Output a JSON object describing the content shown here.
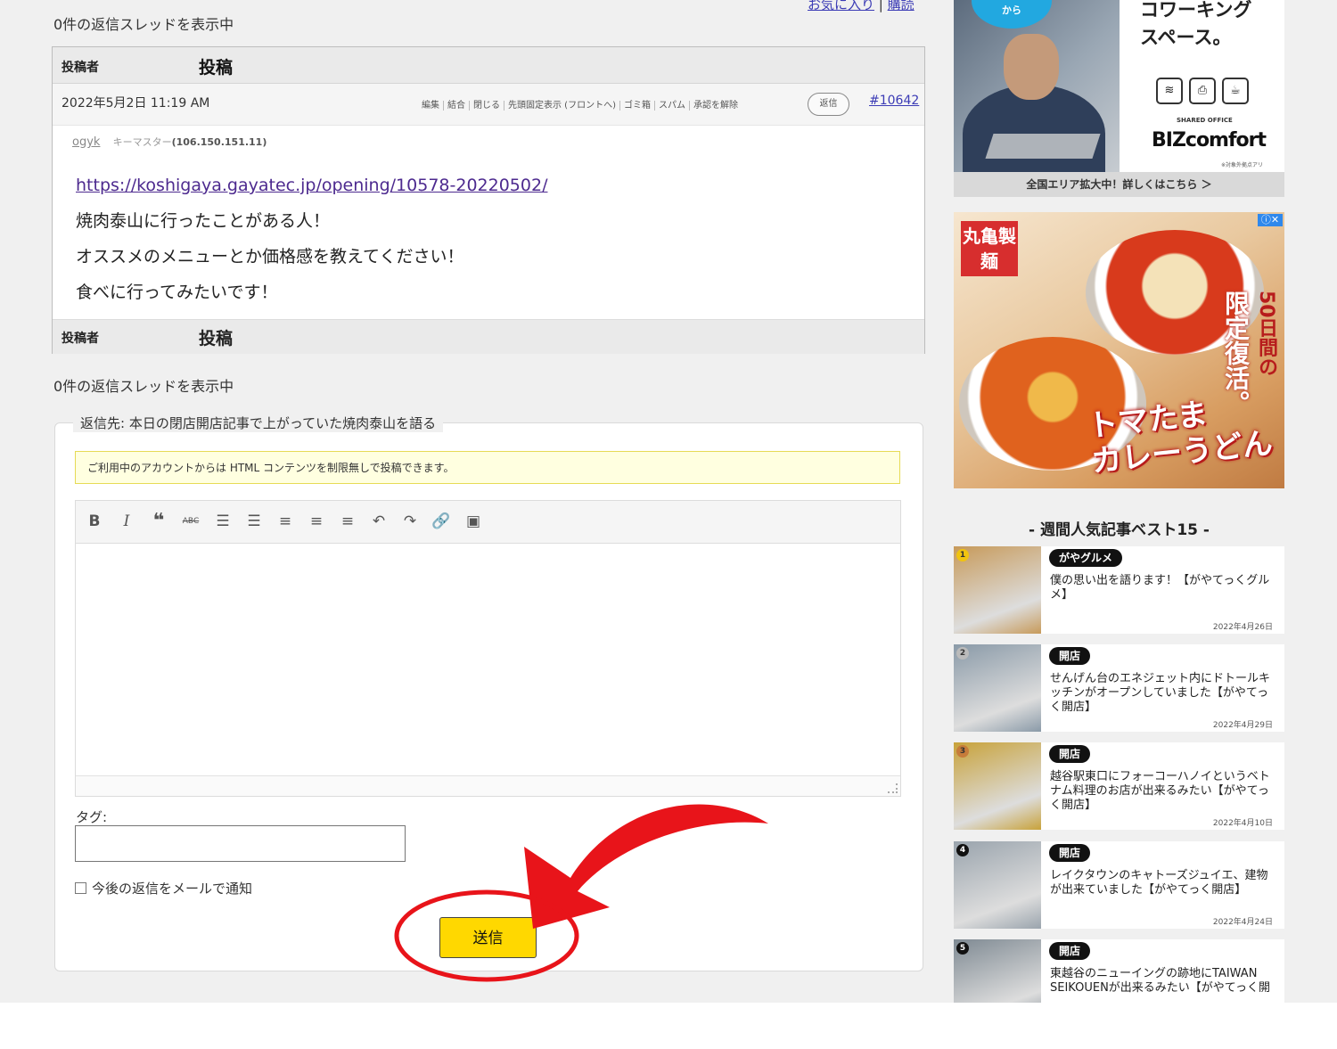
{
  "top_links": {
    "favorite": "お気に入り",
    "separator": "|",
    "subscribe": "購読"
  },
  "thread_count_top": "0件の返信スレッドを表示中",
  "thread_count_bottom": "0件の返信スレッドを表示中",
  "table": {
    "col_author": "投稿者",
    "col_post": "投稿"
  },
  "post": {
    "date": "2022年5月2日 11:19 AM",
    "admin_links": [
      "編集",
      "結合",
      "閉じる",
      "先頭固定表示 (フロントへ)",
      "ゴミ箱",
      "スパム",
      "承認を解除"
    ],
    "reply_button": "返信",
    "permalink": "#10642",
    "author_name": "ogyk",
    "author_role": "キーマスター",
    "author_ip": "(106.150.151.11)",
    "link": "https://koshigaya.gayatec.jp/opening/10578-20220502/",
    "lines": [
      "焼肉泰山に行ったことがある人！",
      "オススメのメニューとか価格感を教えてください！",
      "食べに行ってみたいです！"
    ]
  },
  "reply_form": {
    "legend": "返信先: 本日の閉店開店記事で上がっていた焼肉泰山を語る",
    "notice": "ご利用中のアカウントからは HTML コンテンツを制限無しで投稿できます。",
    "toolbar": [
      {
        "name": "bold-icon",
        "glyph": "B"
      },
      {
        "name": "italic-icon",
        "glyph": "I"
      },
      {
        "name": "blockquote-icon",
        "glyph": "❝"
      },
      {
        "name": "strikethrough-icon",
        "glyph": "ABC"
      },
      {
        "name": "bullet-list-icon",
        "glyph": "☰"
      },
      {
        "name": "numbered-list-icon",
        "glyph": "☰"
      },
      {
        "name": "align-left-icon",
        "glyph": "≡"
      },
      {
        "name": "align-center-icon",
        "glyph": "≡"
      },
      {
        "name": "align-right-icon",
        "glyph": "≡"
      },
      {
        "name": "undo-icon",
        "glyph": "↶"
      },
      {
        "name": "redo-icon",
        "glyph": "↷"
      },
      {
        "name": "link-icon",
        "glyph": "🔗"
      },
      {
        "name": "image-icon",
        "glyph": "▣"
      }
    ],
    "tags_label": "タグ:",
    "tags_value": "",
    "notify_label": "今後の返信をメールで通知",
    "submit_label": "送信"
  },
  "annotation_color": "#e8141a",
  "sidebar": {
    "ad1": {
      "bubble": "から",
      "line1": "コワーキング",
      "line2": "スペース。",
      "brand_small": "SHARED OFFICE",
      "brand": "BIZcomfort",
      "footnote": "※対象外拠点アリ",
      "banner": "全国エリア拡大中！詳しくはこちら ＞"
    },
    "ad2": {
      "logo": "丸亀製麺",
      "vertical": "50日間の",
      "vertical2": "限定復活。",
      "headline1": "トマたま",
      "headline2": "カレーうどん"
    },
    "ranking_title": "- 週間人気記事ベスト15 -",
    "ranking": [
      {
        "rank": "1",
        "category": "がやグルメ",
        "title": "僕の思い出を語ります！【がやてっくグルメ】",
        "date": "2022年4月26日",
        "thumb": "#c79a5a",
        "badge": "#f1c40f"
      },
      {
        "rank": "2",
        "category": "開店",
        "title": "せんげん台のエネジェット内にドトールキッチンがオープンしていました【がやてっく開店】",
        "date": "2022年4月29日",
        "thumb": "#8a9aa8",
        "badge": "#bbbbbb"
      },
      {
        "rank": "3",
        "category": "開店",
        "title": "越谷駅東口にフォーコーハノイというベトナム料理のお店が出来るみたい【がやてっく開店】",
        "date": "2022年4月10日",
        "thumb": "#c8a23a",
        "badge": "#c67c3a"
      },
      {
        "rank": "4",
        "category": "開店",
        "title": "レイクタウンのキャトーズジュイエ、建物が出来ていました【がやてっく開店】",
        "date": "2022年4月24日",
        "thumb": "#9aa4ad",
        "badge": "#111111"
      },
      {
        "rank": "5",
        "category": "開店",
        "title": "東越谷のニューイングの跡地にTAIWAN SEIKOUENが出来るみたい【がやてっく開",
        "date": "",
        "thumb": "#7f8a93",
        "badge": "#111111"
      }
    ]
  }
}
